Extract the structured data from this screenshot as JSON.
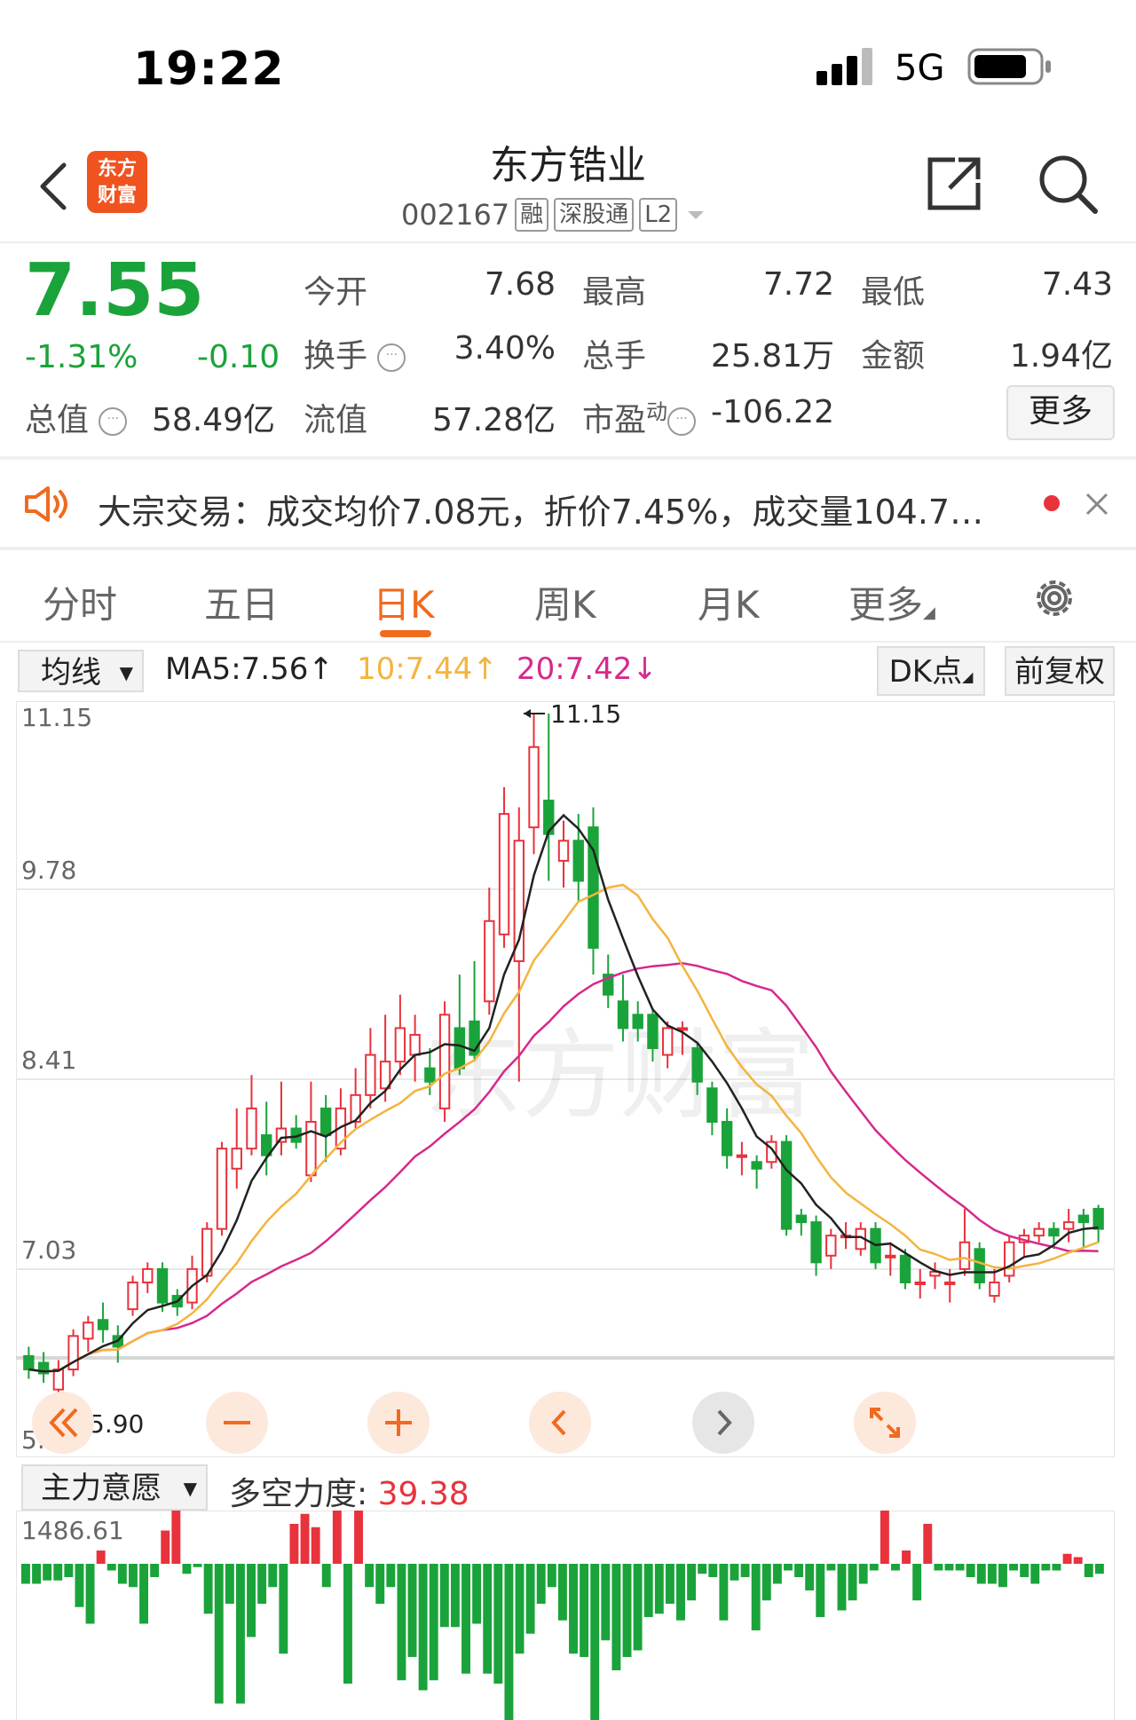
{
  "status": {
    "time": "19:22",
    "network": "5G"
  },
  "header": {
    "stock_name": "东方锆业",
    "stock_code": "002167",
    "tags": [
      "融",
      "深股通",
      "L2"
    ]
  },
  "quote": {
    "price": "7.55",
    "change_pct": "-1.31%",
    "change": "-0.10",
    "open_label": "今开",
    "open": "7.68",
    "high_label": "最高",
    "high": "7.72",
    "low_label": "最低",
    "low": "7.43",
    "turnover_label": "换手",
    "turnover": "3.40%",
    "volume_label": "总手",
    "volume": "25.81万",
    "amount_label": "金额",
    "amount": "1.94亿",
    "mcap_label": "总值",
    "mcap": "58.49亿",
    "float_label": "流值",
    "float": "57.28亿",
    "pe_label": "市盈",
    "pe_sup": "动",
    "pe": "-106.22",
    "more": "更多"
  },
  "notice": {
    "text": "大宗交易：成交均价7.08元，折价7.45%，成交量104.7…"
  },
  "tabs": [
    "分时",
    "五日",
    "日K",
    "周K",
    "月K",
    "更多"
  ],
  "indicators": {
    "select": "均线",
    "ma5": "MA5:7.56",
    "ma10": "10:7.44",
    "ma20": "20:7.42",
    "dk": "DK点",
    "fq": "前复权"
  },
  "axis": {
    "y1": "11.15",
    "y2": "9.78",
    "y3": "8.41",
    "y4": "7.03",
    "y5": "5.66"
  },
  "annotations": {
    "high": "11.15",
    "low": "5.90"
  },
  "lower": {
    "select": "主力意愿",
    "label": "多空力度:",
    "value": "39.38",
    "max": "1486.61"
  },
  "colors": {
    "up": "#e8323c",
    "down": "#1aa33a",
    "accent": "#f06a1f",
    "ma5": "#222222",
    "ma10": "#f4b43e",
    "ma20": "#d6298c"
  },
  "chart_data": {
    "type": "candlestick",
    "ylim": [
      5.66,
      11.15
    ],
    "candles": [
      {
        "o": 6.35,
        "c": 6.25,
        "h": 6.42,
        "l": 6.18
      },
      {
        "o": 6.3,
        "c": 6.22,
        "h": 6.38,
        "l": 6.15
      },
      {
        "o": 6.1,
        "c": 6.25,
        "h": 6.32,
        "l": 6.02
      },
      {
        "o": 6.25,
        "c": 6.5,
        "h": 6.55,
        "l": 6.2
      },
      {
        "o": 6.48,
        "c": 6.6,
        "h": 6.65,
        "l": 6.38
      },
      {
        "o": 6.62,
        "c": 6.55,
        "h": 6.75,
        "l": 6.45
      },
      {
        "o": 6.5,
        "c": 6.42,
        "h": 6.58,
        "l": 6.3
      },
      {
        "o": 6.7,
        "c": 6.9,
        "h": 6.95,
        "l": 6.65
      },
      {
        "o": 6.9,
        "c": 7.0,
        "h": 7.05,
        "l": 6.82
      },
      {
        "o": 7.0,
        "c": 6.75,
        "h": 7.05,
        "l": 6.68
      },
      {
        "o": 6.8,
        "c": 6.72,
        "h": 6.85,
        "l": 6.65
      },
      {
        "o": 6.75,
        "c": 7.0,
        "h": 7.1,
        "l": 6.7
      },
      {
        "o": 6.95,
        "c": 7.3,
        "h": 7.35,
        "l": 6.9
      },
      {
        "o": 7.3,
        "c": 7.9,
        "h": 7.95,
        "l": 7.25
      },
      {
        "o": 7.75,
        "c": 7.9,
        "h": 8.2,
        "l": 7.6
      },
      {
        "o": 7.9,
        "c": 8.2,
        "h": 8.45,
        "l": 7.85
      },
      {
        "o": 8.0,
        "c": 7.85,
        "h": 8.25,
        "l": 7.7
      },
      {
        "o": 7.95,
        "c": 8.05,
        "h": 8.4,
        "l": 7.85
      },
      {
        "o": 8.05,
        "c": 7.95,
        "h": 8.15,
        "l": 7.9
      },
      {
        "o": 7.7,
        "c": 8.1,
        "h": 8.4,
        "l": 7.65
      },
      {
        "o": 8.2,
        "c": 8.0,
        "h": 8.3,
        "l": 7.8
      },
      {
        "o": 7.9,
        "c": 8.2,
        "h": 8.35,
        "l": 7.85
      },
      {
        "o": 8.1,
        "c": 8.3,
        "h": 8.5,
        "l": 8.05
      },
      {
        "o": 8.3,
        "c": 8.6,
        "h": 8.8,
        "l": 8.2
      },
      {
        "o": 8.35,
        "c": 8.55,
        "h": 8.9,
        "l": 8.25
      },
      {
        "o": 8.55,
        "c": 8.8,
        "h": 9.05,
        "l": 8.45
      },
      {
        "o": 8.6,
        "c": 8.75,
        "h": 8.9,
        "l": 8.4
      },
      {
        "o": 8.5,
        "c": 8.4,
        "h": 8.65,
        "l": 8.3
      },
      {
        "o": 8.2,
        "c": 8.9,
        "h": 9.0,
        "l": 8.1
      },
      {
        "o": 8.8,
        "c": 8.5,
        "h": 9.2,
        "l": 8.45
      },
      {
        "o": 8.85,
        "c": 8.6,
        "h": 9.3,
        "l": 8.55
      },
      {
        "o": 9.0,
        "c": 9.6,
        "h": 9.85,
        "l": 8.9
      },
      {
        "o": 9.5,
        "c": 10.4,
        "h": 10.6,
        "l": 9.4
      },
      {
        "o": 9.3,
        "c": 10.2,
        "h": 10.45,
        "l": 8.4
      },
      {
        "o": 10.3,
        "c": 10.9,
        "h": 11.15,
        "l": 10.1
      },
      {
        "o": 10.5,
        "c": 10.25,
        "h": 11.15,
        "l": 9.9
      },
      {
        "o": 10.05,
        "c": 10.2,
        "h": 10.35,
        "l": 9.85
      },
      {
        "o": 10.2,
        "c": 9.9,
        "h": 10.4,
        "l": 9.75
      },
      {
        "o": 10.3,
        "c": 9.4,
        "h": 10.45,
        "l": 9.2
      },
      {
        "o": 9.2,
        "c": 9.05,
        "h": 9.35,
        "l": 8.95
      },
      {
        "o": 9.0,
        "c": 8.8,
        "h": 9.2,
        "l": 8.7
      },
      {
        "o": 8.9,
        "c": 8.8,
        "h": 9.0,
        "l": 8.7
      },
      {
        "o": 8.9,
        "c": 8.65,
        "h": 8.95,
        "l": 8.55
      },
      {
        "o": 8.6,
        "c": 8.8,
        "h": 8.85,
        "l": 8.5
      },
      {
        "o": 8.8,
        "c": 8.8,
        "h": 8.85,
        "l": 8.6
      },
      {
        "o": 8.65,
        "c": 8.4,
        "h": 8.7,
        "l": 8.3
      },
      {
        "o": 8.35,
        "c": 8.1,
        "h": 8.4,
        "l": 8.0
      },
      {
        "o": 8.1,
        "c": 7.85,
        "h": 8.2,
        "l": 7.75
      },
      {
        "o": 7.85,
        "c": 7.85,
        "h": 7.95,
        "l": 7.7
      },
      {
        "o": 7.8,
        "c": 7.75,
        "h": 7.85,
        "l": 7.6
      },
      {
        "o": 7.8,
        "c": 7.95,
        "h": 8.0,
        "l": 7.75
      },
      {
        "o": 7.95,
        "c": 7.3,
        "h": 8.0,
        "l": 7.25
      },
      {
        "o": 7.4,
        "c": 7.35,
        "h": 7.45,
        "l": 7.25
      },
      {
        "o": 7.35,
        "c": 7.05,
        "h": 7.4,
        "l": 6.95
      },
      {
        "o": 7.1,
        "c": 7.25,
        "h": 7.3,
        "l": 7.0
      },
      {
        "o": 7.25,
        "c": 7.25,
        "h": 7.35,
        "l": 7.15
      },
      {
        "o": 7.15,
        "c": 7.3,
        "h": 7.35,
        "l": 7.1
      },
      {
        "o": 7.3,
        "c": 7.05,
        "h": 7.35,
        "l": 7.0
      },
      {
        "o": 7.1,
        "c": 7.1,
        "h": 7.2,
        "l": 6.95
      },
      {
        "o": 7.1,
        "c": 6.9,
        "h": 7.15,
        "l": 6.85
      },
      {
        "o": 6.9,
        "c": 6.9,
        "h": 7.0,
        "l": 6.78
      },
      {
        "o": 6.95,
        "c": 6.98,
        "h": 7.05,
        "l": 6.85
      },
      {
        "o": 6.9,
        "c": 6.9,
        "h": 7.0,
        "l": 6.75
      },
      {
        "o": 7.0,
        "c": 7.2,
        "h": 7.45,
        "l": 6.95
      },
      {
        "o": 7.15,
        "c": 6.9,
        "h": 7.2,
        "l": 6.85
      },
      {
        "o": 6.8,
        "c": 6.9,
        "h": 7.0,
        "l": 6.75
      },
      {
        "o": 6.95,
        "c": 7.2,
        "h": 7.25,
        "l": 6.9
      },
      {
        "o": 7.2,
        "c": 7.25,
        "h": 7.3,
        "l": 7.1
      },
      {
        "o": 7.25,
        "c": 7.3,
        "h": 7.35,
        "l": 7.2
      },
      {
        "o": 7.3,
        "c": 7.25,
        "h": 7.35,
        "l": 7.15
      },
      {
        "o": 7.3,
        "c": 7.35,
        "h": 7.45,
        "l": 7.2
      },
      {
        "o": 7.4,
        "c": 7.35,
        "h": 7.45,
        "l": 7.15
      },
      {
        "o": 7.45,
        "c": 7.3,
        "h": 7.48,
        "l": 7.2
      }
    ],
    "volume": [
      -60,
      -60,
      -50,
      -50,
      -40,
      -130,
      -180,
      40,
      -20,
      -60,
      -70,
      -180,
      -40,
      100,
      400,
      -30,
      -10,
      -150,
      -420,
      -120,
      -420,
      -220,
      -120,
      -70,
      -270,
      120,
      150,
      110,
      -70,
      210,
      -360,
      330,
      -70,
      -120,
      -70,
      -350,
      -280,
      -380,
      -350,
      -190,
      -190,
      -330,
      -180,
      -330,
      -360,
      -470,
      -270,
      -210,
      -120,
      -70,
      -170,
      -270,
      -280,
      -470,
      -230,
      -320,
      -280,
      -260,
      -160,
      -150,
      -120,
      -170,
      -110,
      -30,
      -40,
      -170,
      -50,
      -40,
      -200,
      -110,
      -60,
      -20,
      -40,
      -80,
      -160,
      -20,
      -140,
      -110,
      -60,
      -20,
      170,
      -20,
      40,
      -110,
      120,
      -20,
      -20,
      -20,
      -40,
      -60,
      -60,
      -70,
      -20,
      -40,
      -60,
      -20,
      -20,
      30,
      20,
      -40,
      -30
    ]
  }
}
